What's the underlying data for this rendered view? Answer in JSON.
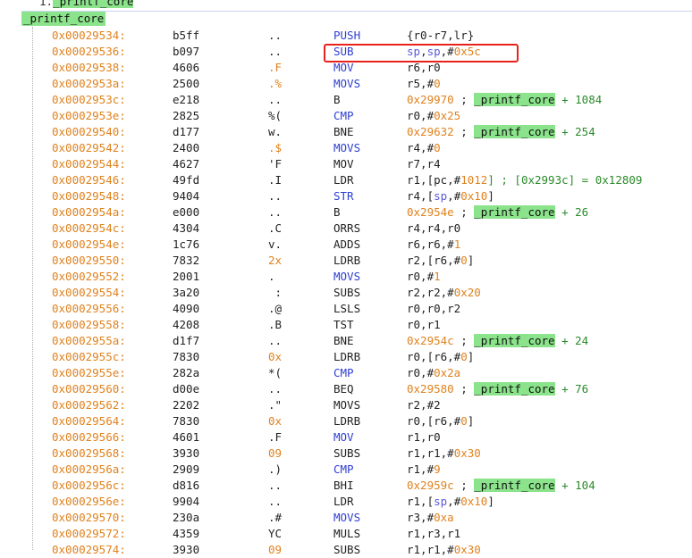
{
  "header": {
    "index": "1.",
    "symbol": "_printf_core"
  },
  "function_label": "_printf_core",
  "highlight_row": 1,
  "rows": [
    {
      "addr": "0x00029534:",
      "hex": "b5ff",
      "ascii": "..",
      "mnem": "PUSH",
      "mc": "blue",
      "ops": [
        {
          "t": "{r0-r7,lr}"
        }
      ]
    },
    {
      "addr": "0x00029536:",
      "hex": "b097",
      "ascii": "..",
      "mnem": "SUB",
      "mc": "blue",
      "ops": [
        {
          "t": "sp",
          "c": "o-reg"
        },
        {
          "t": ","
        },
        {
          "t": "sp",
          "c": "o-reg"
        },
        {
          "t": ",#"
        },
        {
          "t": "0x5c",
          "c": "o-num"
        }
      ]
    },
    {
      "addr": "0x00029538:",
      "hex": "4606",
      "ascii": ".F",
      "ac": "orange",
      "mnem": "MOV",
      "mc": "blue",
      "ops": [
        {
          "t": "r6,r0"
        }
      ]
    },
    {
      "addr": "0x0002953a:",
      "hex": "2500",
      "ascii": ".%",
      "ac": "orange",
      "mnem": "MOVS",
      "mc": "blue",
      "ops": [
        {
          "t": "r5,#"
        },
        {
          "t": "0",
          "c": "o-num"
        }
      ]
    },
    {
      "addr": "0x0002953c:",
      "hex": "e218",
      "ascii": "..",
      "mnem": "B",
      "ops": [
        {
          "t": "0x29970",
          "c": "o-num"
        },
        {
          "t": " ; "
        },
        {
          "t": "_printf_core",
          "c": "o-sym"
        },
        {
          "t": " + 1084",
          "c": "o-cmt"
        }
      ]
    },
    {
      "addr": "0x0002953e:",
      "hex": "2825",
      "ascii": "%(",
      "mnem": "CMP",
      "mc": "blue",
      "ops": [
        {
          "t": "r0,#"
        },
        {
          "t": "0x25",
          "c": "o-num"
        }
      ]
    },
    {
      "addr": "0x00029540:",
      "hex": "d177",
      "ascii": "w.",
      "mnem": "BNE",
      "ops": [
        {
          "t": "0x29632",
          "c": "o-num"
        },
        {
          "t": " ; "
        },
        {
          "t": "_printf_core",
          "c": "o-sym"
        },
        {
          "t": " + 254",
          "c": "o-cmt"
        }
      ]
    },
    {
      "addr": "0x00029542:",
      "hex": "2400",
      "ascii": ".$",
      "ac": "orange",
      "mnem": "MOVS",
      "mc": "blue",
      "ops": [
        {
          "t": "r4,#"
        },
        {
          "t": "0",
          "c": "o-num"
        }
      ]
    },
    {
      "addr": "0x00029544:",
      "hex": "4627",
      "ascii": "'F",
      "mnem": "MOV",
      "ops": [
        {
          "t": "r7,r4"
        }
      ]
    },
    {
      "addr": "0x00029546:",
      "hex": "49fd",
      "ascii": ".I",
      "mnem": "LDR",
      "ops": [
        {
          "t": "r1,[pc,#"
        },
        {
          "t": "1012",
          "c": "o-num"
        },
        {
          "t": "] ; [0x2993c] = 0x12809",
          "c": "o-cmt"
        }
      ]
    },
    {
      "addr": "0x00029548:",
      "hex": "9404",
      "ascii": "..",
      "mnem": "STR",
      "mc": "blue",
      "ops": [
        {
          "t": "r4,["
        },
        {
          "t": "sp",
          "c": "o-reg"
        },
        {
          "t": ",#"
        },
        {
          "t": "0x10",
          "c": "o-num"
        },
        {
          "t": "]"
        }
      ]
    },
    {
      "addr": "0x0002954a:",
      "hex": "e000",
      "ascii": "..",
      "mnem": "B",
      "ops": [
        {
          "t": "0x2954e",
          "c": "o-num"
        },
        {
          "t": " ; "
        },
        {
          "t": "_printf_core",
          "c": "o-sym"
        },
        {
          "t": " + 26",
          "c": "o-cmt"
        }
      ]
    },
    {
      "addr": "0x0002954c:",
      "hex": "4304",
      "ascii": ".C",
      "mnem": "ORRS",
      "ops": [
        {
          "t": "r4,r4,r0"
        }
      ]
    },
    {
      "addr": "0x0002954e:",
      "hex": "1c76",
      "ascii": "v.",
      "mnem": "ADDS",
      "ops": [
        {
          "t": "r6,r6,#"
        },
        {
          "t": "1",
          "c": "o-num"
        }
      ]
    },
    {
      "addr": "0x00029550:",
      "hex": "7832",
      "ascii": "2x",
      "ac": "orange",
      "mnem": "LDRB",
      "ops": [
        {
          "t": "r2,[r6,#"
        },
        {
          "t": "0",
          "c": "o-num"
        },
        {
          "t": "]"
        }
      ]
    },
    {
      "addr": "0x00029552:",
      "hex": "2001",
      "ascii": ". ",
      "mnem": "MOVS",
      "mc": "blue",
      "ops": [
        {
          "t": "r0,#"
        },
        {
          "t": "1",
          "c": "o-num"
        }
      ]
    },
    {
      "addr": "0x00029554:",
      "hex": "3a20",
      "ascii": " :",
      "mnem": "SUBS",
      "ops": [
        {
          "t": "r2,r2,#"
        },
        {
          "t": "0x20",
          "c": "o-num"
        }
      ]
    },
    {
      "addr": "0x00029556:",
      "hex": "4090",
      "ascii": ".@",
      "mnem": "LSLS",
      "ops": [
        {
          "t": "r0,r0,r2"
        }
      ]
    },
    {
      "addr": "0x00029558:",
      "hex": "4208",
      "ascii": ".B",
      "mnem": "TST",
      "ops": [
        {
          "t": "r0,r1"
        }
      ]
    },
    {
      "addr": "0x0002955a:",
      "hex": "d1f7",
      "ascii": "..",
      "mnem": "BNE",
      "ops": [
        {
          "t": "0x2954c",
          "c": "o-num"
        },
        {
          "t": " ; "
        },
        {
          "t": "_printf_core",
          "c": "o-sym"
        },
        {
          "t": " + 24",
          "c": "o-cmt"
        }
      ]
    },
    {
      "addr": "0x0002955c:",
      "hex": "7830",
      "ascii": "0x",
      "ac": "orange",
      "mnem": "LDRB",
      "ops": [
        {
          "t": "r0,[r6,#"
        },
        {
          "t": "0",
          "c": "o-num"
        },
        {
          "t": "]"
        }
      ]
    },
    {
      "addr": "0x0002955e:",
      "hex": "282a",
      "ascii": "*(",
      "mnem": "CMP",
      "mc": "blue",
      "ops": [
        {
          "t": "r0,#"
        },
        {
          "t": "0x2a",
          "c": "o-num"
        }
      ]
    },
    {
      "addr": "0x00029560:",
      "hex": "d00e",
      "ascii": "..",
      "mnem": "BEQ",
      "ops": [
        {
          "t": "0x29580",
          "c": "o-num"
        },
        {
          "t": " ; "
        },
        {
          "t": "_printf_core",
          "c": "o-sym"
        },
        {
          "t": " + 76",
          "c": "o-cmt"
        }
      ]
    },
    {
      "addr": "0x00029562:",
      "hex": "2202",
      "ascii": ".\"",
      "mnem": "MOVS",
      "ops": [
        {
          "t": "r2,#2"
        }
      ]
    },
    {
      "addr": "0x00029564:",
      "hex": "7830",
      "ascii": "0x",
      "ac": "orange",
      "mnem": "LDRB",
      "ops": [
        {
          "t": "r0,[r6,#"
        },
        {
          "t": "0",
          "c": "o-num"
        },
        {
          "t": "]"
        }
      ]
    },
    {
      "addr": "0x00029566:",
      "hex": "4601",
      "ascii": ".F",
      "mnem": "MOV",
      "mc": "blue",
      "ops": [
        {
          "t": "r1,r0"
        }
      ]
    },
    {
      "addr": "0x00029568:",
      "hex": "3930",
      "ascii": "09",
      "ac": "orange",
      "mnem": "SUBS",
      "ops": [
        {
          "t": "r1,r1,#"
        },
        {
          "t": "0x30",
          "c": "o-num"
        }
      ]
    },
    {
      "addr": "0x0002956a:",
      "hex": "2909",
      "ascii": ".)",
      "mnem": "CMP",
      "mc": "blue",
      "ops": [
        {
          "t": "r1,#"
        },
        {
          "t": "9",
          "c": "o-num"
        }
      ]
    },
    {
      "addr": "0x0002956c:",
      "hex": "d816",
      "ascii": "..",
      "mnem": "BHI",
      "ops": [
        {
          "t": "0x2959c",
          "c": "o-num"
        },
        {
          "t": " ; "
        },
        {
          "t": "_printf_core",
          "c": "o-sym"
        },
        {
          "t": " + 104",
          "c": "o-cmt"
        }
      ]
    },
    {
      "addr": "0x0002956e:",
      "hex": "9904",
      "ascii": "..",
      "mnem": "LDR",
      "ops": [
        {
          "t": "r1,["
        },
        {
          "t": "sp",
          "c": "o-reg"
        },
        {
          "t": ",#"
        },
        {
          "t": "0x10",
          "c": "o-num"
        },
        {
          "t": "]"
        }
      ]
    },
    {
      "addr": "0x00029570:",
      "hex": "230a",
      "ascii": ".#",
      "mnem": "MOVS",
      "mc": "blue",
      "ops": [
        {
          "t": "r3,#"
        },
        {
          "t": "0xa",
          "c": "o-num"
        }
      ]
    },
    {
      "addr": "0x00029572:",
      "hex": "4359",
      "ascii": "YC",
      "mnem": "MULS",
      "ops": [
        {
          "t": "r1,r3,r1"
        }
      ]
    },
    {
      "addr": "0x00029574:",
      "hex": "3930",
      "ascii": "09",
      "ac": "orange",
      "mnem": "SUBS",
      "ops": [
        {
          "t": "r1,r1,#"
        },
        {
          "t": "0x30",
          "c": "o-num"
        }
      ]
    }
  ]
}
